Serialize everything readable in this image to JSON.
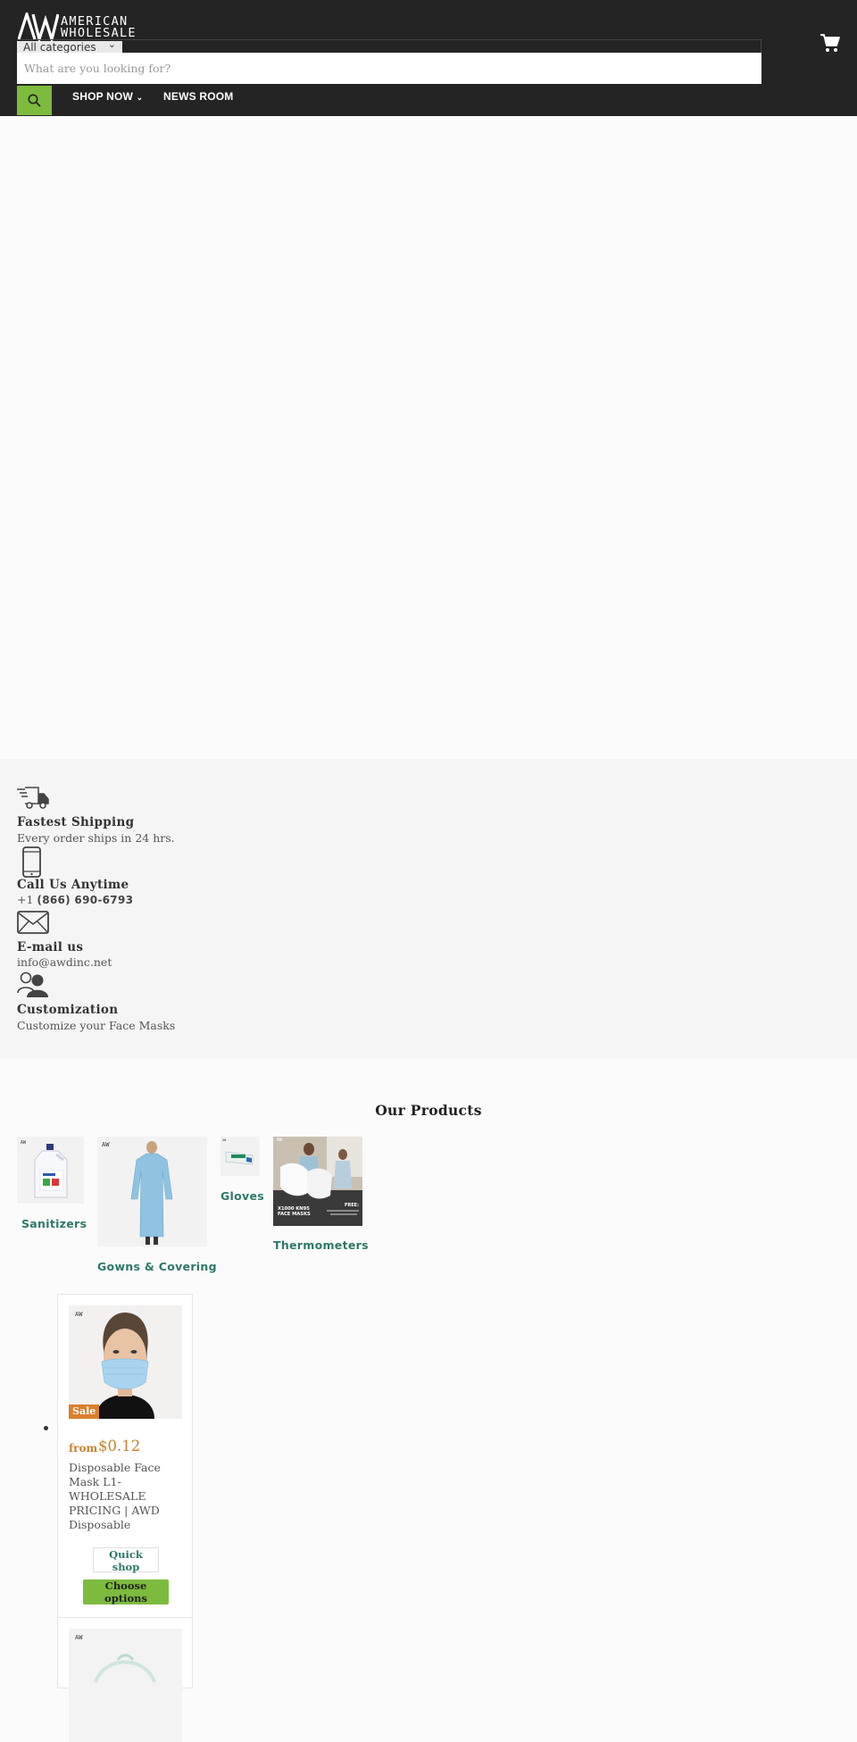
{
  "header": {
    "logo_line1": "AMERICAN",
    "logo_line2": "WHOLESALE",
    "category_select": "All categories",
    "search_placeholder": "What are you looking for?",
    "nav": [
      {
        "label": "SHOP NOW",
        "has_dropdown": true
      },
      {
        "label": "NEWS ROOM",
        "has_dropdown": false
      }
    ],
    "icons": {
      "search": "search-icon",
      "cart": "cart-icon",
      "dropdown": "chevron-down-icon"
    }
  },
  "features": [
    {
      "icon": "truck-icon",
      "title": "Fastest Shipping",
      "text": "Every order ships in 24 hrs."
    },
    {
      "icon": "phone-icon",
      "title": "Call Us Anytime",
      "text_prefix": "+1",
      "text": "(866) 690-6793"
    },
    {
      "icon": "envelope-icon",
      "title": "E-mail us",
      "text": "info@awdinc.net"
    },
    {
      "icon": "user-icon",
      "title": "Customization",
      "text": "Customize your Face Masks"
    }
  ],
  "products_section": {
    "title": "Our Products",
    "categories": [
      {
        "label": "Sanitizers"
      },
      {
        "label": "Gowns & Covering"
      },
      {
        "label": "Gloves"
      },
      {
        "label": "Thermometers",
        "image_text": [
          "KN95",
          "FACE MASKS",
          "FREE:"
        ]
      }
    ]
  },
  "product_cards": [
    {
      "badge": "Sale",
      "price_prefix": "from",
      "price": "$0.12",
      "title": "Disposable Face Mask L1-WHOLESALE PRICING | AWD Disposable",
      "quick_shop_label": "Quick shop",
      "choose_options_label": "Choose options"
    }
  ],
  "colors": {
    "header_bg": "#242424",
    "accent_green": "#7cbb3e",
    "link_teal": "#2e7868",
    "price_orange": "#c8822c",
    "features_bg": "#f5f5f5"
  }
}
